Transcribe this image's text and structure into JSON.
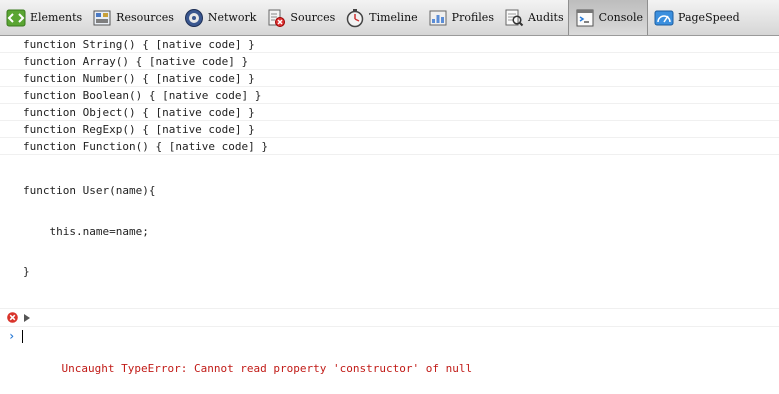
{
  "tabs": [
    {
      "label": "Elements",
      "icon": "elements-icon"
    },
    {
      "label": "Resources",
      "icon": "resources-icon"
    },
    {
      "label": "Network",
      "icon": "network-icon"
    },
    {
      "label": "Sources",
      "icon": "sources-icon"
    },
    {
      "label": "Timeline",
      "icon": "timeline-icon"
    },
    {
      "label": "Profiles",
      "icon": "profiles-icon"
    },
    {
      "label": "Audits",
      "icon": "audits-icon"
    },
    {
      "label": "Console",
      "icon": "console-icon",
      "active": true
    },
    {
      "label": "PageSpeed",
      "icon": "pagespeed-icon"
    }
  ],
  "console": {
    "lines": [
      "function String() { [native code] }",
      "function Array() { [native code] }",
      "function Number() { [native code] }",
      "function Boolean() { [native code] }",
      "function Object() { [native code] }",
      "function RegExp() { [native code] }",
      "function Function() { [native code] }"
    ],
    "user_function": [
      "function User(name){",
      "    this.name=name;",
      "}"
    ],
    "error": "Uncaught TypeError: Cannot read property 'constructor' of null",
    "prompt_symbol": "›",
    "input_value": ""
  },
  "colors": {
    "error": "#c11b17",
    "prompt": "#2b7bd6"
  }
}
